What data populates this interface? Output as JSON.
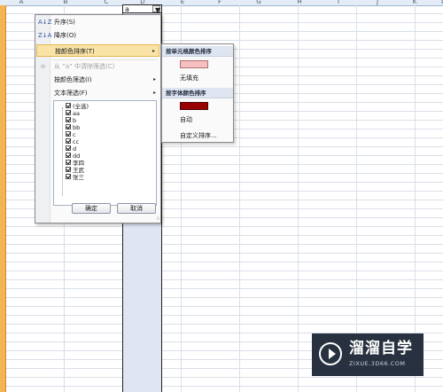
{
  "spreadsheet": {
    "column_letters": [
      "A",
      "B",
      "C",
      "D",
      "E",
      "F",
      "G",
      "H",
      "I",
      "J",
      "K",
      "L"
    ],
    "active_cell_value": "a",
    "dropdown_glyph": "▼"
  },
  "filter_menu": {
    "sort_asc": {
      "icon": "A↓Z",
      "label": "升序(S)"
    },
    "sort_desc": {
      "icon": "Z↓A",
      "label": "降序(O)"
    },
    "sort_by_color": {
      "label": "按颜色排序(T)",
      "arrow": "▸"
    },
    "clear_filter": {
      "icon": "⊗",
      "label": "从 “a” 中清除筛选(C)"
    },
    "filter_by_color": {
      "label": "按颜色筛选(I)",
      "arrow": "▸"
    },
    "text_filter": {
      "label": "文本筛选(F)",
      "arrow": "▸"
    },
    "values": [
      {
        "label": "(全选)",
        "checked": true
      },
      {
        "label": "aa",
        "checked": true
      },
      {
        "label": "b",
        "checked": true
      },
      {
        "label": "bb",
        "checked": true
      },
      {
        "label": "c",
        "checked": true
      },
      {
        "label": "cc",
        "checked": true
      },
      {
        "label": "d",
        "checked": true
      },
      {
        "label": "dd",
        "checked": true
      },
      {
        "label": "李四",
        "checked": true
      },
      {
        "label": "王武",
        "checked": true
      },
      {
        "label": "张三",
        "checked": true
      }
    ],
    "ok_button": "确定",
    "cancel_button": "取消",
    "resize_grip": "⁞⁞"
  },
  "color_submenu": {
    "cell_color_header": "按单元格颜色排序",
    "cell_color_swatch": "#f7c0c0",
    "no_fill": "无填充",
    "font_color_header": "按字体颜色排序",
    "font_color_swatch": "#990000",
    "automatic": "自动",
    "custom_sort": "自定义排序..."
  },
  "watermark": {
    "title": "溜溜自学",
    "url": "ZIXUE.3D66.COM"
  },
  "colors": {
    "highlight": "#f9e3a7",
    "row_header": "#f3b455",
    "selected_column": "#dfe5f3"
  }
}
